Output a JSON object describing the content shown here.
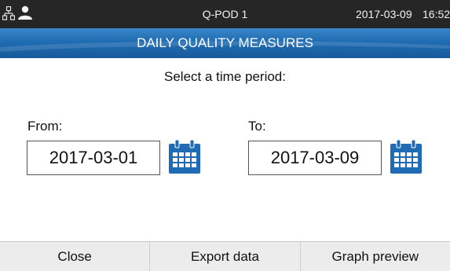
{
  "status_bar": {
    "title": "Q-POD 1",
    "date": "2017-03-09",
    "time": "16:52",
    "icons": [
      "network-icon",
      "user-icon"
    ]
  },
  "header": {
    "title": "DAILY QUALITY MEASURES"
  },
  "main": {
    "prompt": "Select a time period:",
    "from_label": "From:",
    "from_value": "2017-03-01",
    "to_label": "To:",
    "to_value": "2017-03-09",
    "calendar_icon": "calendar-icon"
  },
  "bottom_bar": {
    "close_label": "Close",
    "export_label": "Export data",
    "graph_label": "Graph preview"
  },
  "colors": {
    "status_bar": "#262626",
    "header": "#1f6cb4",
    "calendar": "#1f6cb4",
    "bottom_bar": "#ececec"
  }
}
